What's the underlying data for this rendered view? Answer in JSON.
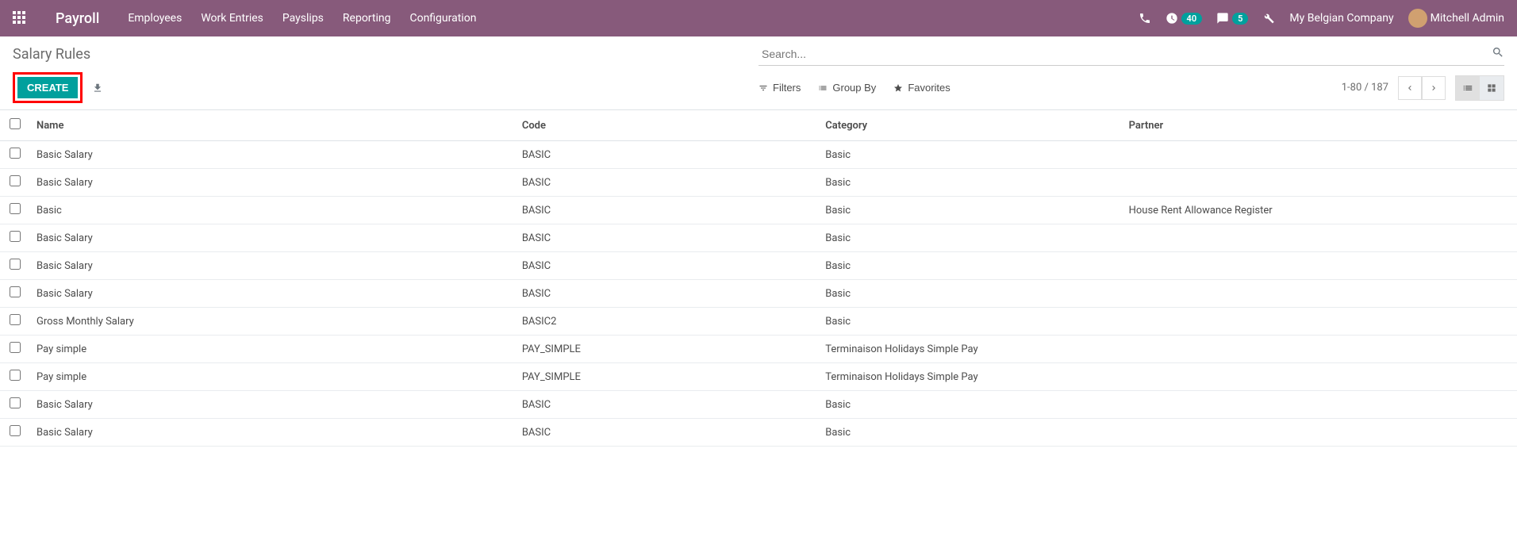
{
  "navbar": {
    "brand": "Payroll",
    "menu": [
      "Employees",
      "Work Entries",
      "Payslips",
      "Reporting",
      "Configuration"
    ],
    "activity_count": "40",
    "messages_count": "5",
    "company": "My Belgian Company",
    "user": "Mitchell Admin"
  },
  "control": {
    "breadcrumb": "Salary Rules",
    "search_placeholder": "Search...",
    "create_label": "CREATE",
    "filters_label": "Filters",
    "groupby_label": "Group By",
    "favorites_label": "Favorites",
    "page_info": "1-80 / 187"
  },
  "columns": {
    "name": "Name",
    "code": "Code",
    "category": "Category",
    "partner": "Partner"
  },
  "rows": [
    {
      "name": "Basic Salary",
      "code": "BASIC",
      "category": "Basic",
      "partner": ""
    },
    {
      "name": "Basic Salary",
      "code": "BASIC",
      "category": "Basic",
      "partner": ""
    },
    {
      "name": "Basic",
      "code": "BASIC",
      "category": "Basic",
      "partner": "House Rent Allowance Register"
    },
    {
      "name": "Basic Salary",
      "code": "BASIC",
      "category": "Basic",
      "partner": ""
    },
    {
      "name": "Basic Salary",
      "code": "BASIC",
      "category": "Basic",
      "partner": ""
    },
    {
      "name": "Basic Salary",
      "code": "BASIC",
      "category": "Basic",
      "partner": ""
    },
    {
      "name": "Gross Monthly Salary",
      "code": "BASIC2",
      "category": "Basic",
      "partner": ""
    },
    {
      "name": "Pay simple",
      "code": "PAY_SIMPLE",
      "category": "Terminaison Holidays Simple Pay",
      "partner": ""
    },
    {
      "name": "Pay simple",
      "code": "PAY_SIMPLE",
      "category": "Terminaison Holidays Simple Pay",
      "partner": ""
    },
    {
      "name": "Basic Salary",
      "code": "BASIC",
      "category": "Basic",
      "partner": ""
    },
    {
      "name": "Basic Salary",
      "code": "BASIC",
      "category": "Basic",
      "partner": ""
    }
  ]
}
